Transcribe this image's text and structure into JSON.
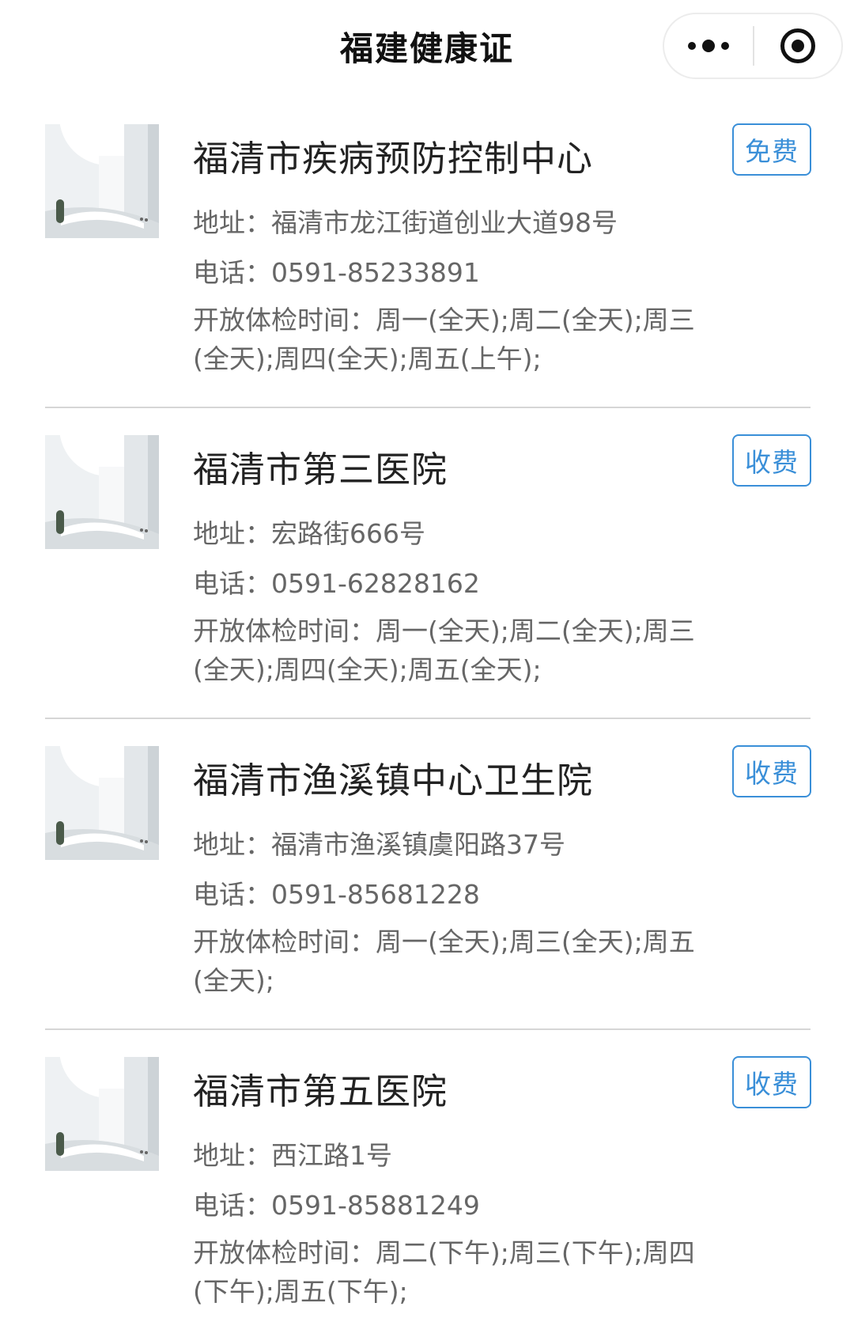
{
  "header": {
    "title": "福建健康证",
    "more_icon": "more-dots-icon",
    "close_icon": "target-close-icon"
  },
  "clinics": [
    {
      "name": "福清市疾病预防控制中心",
      "badge": "免费",
      "address": "地址：福清市龙江街道创业大道98号",
      "phone": "电话：0591-85233891",
      "hours": "开放体检时间：周一(全天);周二(全天);周三(全天);周四(全天);周五(上午);"
    },
    {
      "name": "福清市第三医院",
      "badge": "收费",
      "address": "地址：宏路街666号",
      "phone": "电话：0591-62828162",
      "hours": "开放体检时间：周一(全天);周二(全天);周三(全天);周四(全天);周五(全天);"
    },
    {
      "name": "福清市渔溪镇中心卫生院",
      "badge": "收费",
      "address": "地址：福清市渔溪镇虞阳路37号",
      "phone": "电话：0591-85681228",
      "hours": "开放体检时间：周一(全天);周三(全天);周五(全天);"
    },
    {
      "name": "福清市第五医院",
      "badge": "收费",
      "address": "地址：西江路1号",
      "phone": "电话：0591-85881249",
      "hours": "开放体检时间：周二(下午);周三(下午);周四(下午);周五(下午);"
    }
  ],
  "colors": {
    "accent": "#3a8fd8",
    "text_primary": "#222222",
    "text_secondary": "#666666",
    "divider": "#d6d6d6"
  }
}
